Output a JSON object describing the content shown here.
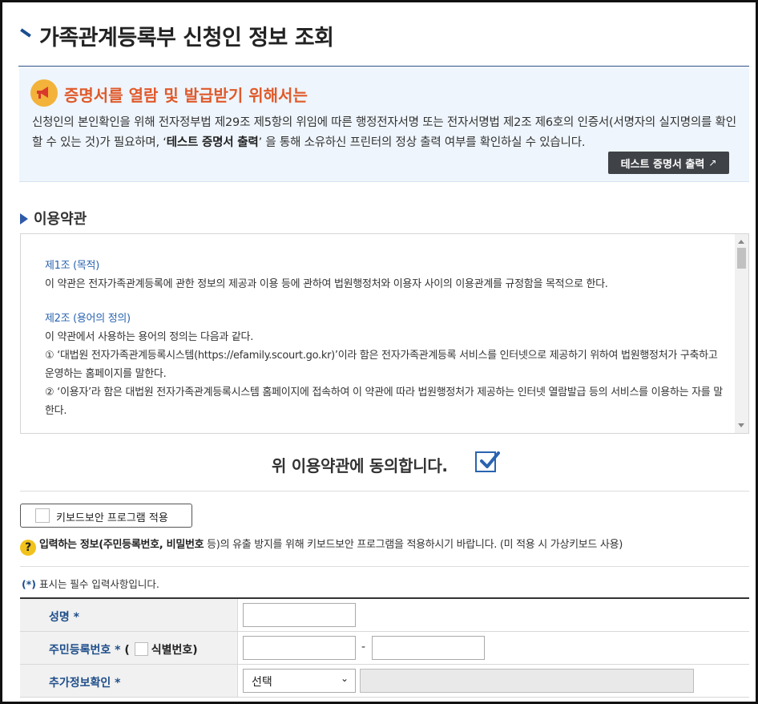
{
  "page": {
    "title": "가족관계등록부 신청인 정보 조회"
  },
  "notice": {
    "icon": "megaphone-icon",
    "heading": "증명서를 열람 및 발급받기 위해서는",
    "body_part1": "신청인의 본인확인을 위해 전자정부법 제29조 제5항의 위임에 따른 행정전자서명 또는 전자서명법 제2조 제6호의 인증서(서명자의 실지명의를 확인할 수 있는 것)가 필요하며, ‘",
    "body_bold": "테스트 증명서 출력",
    "body_part2": "’ 을 통해 소유하신 프린터의 정상 출력 여부를 확인하실 수 있습니다.",
    "test_print_label": "테스트 증명서 출력",
    "external_icon": "↗"
  },
  "terms": {
    "section_title": "이용약관",
    "article1_title": "제1조 (목적)",
    "article1_text": "이 약관은 전자가족관계등록에 관한 정보의 제공과 이용 등에 관하여 법원행정처와 이용자 사이의 이용관계를 규정함을 목적으로 한다.",
    "article2_title": "제2조 (용어의 정의)",
    "article2_intro": "이 약관에서 사용하는 용어의 정의는 다음과 같다.",
    "article2_item1": "① ‘대법원 전자가족관계등록시스템(https://efamily.scourt.go.kr)’이라 함은 전자가족관계등록 서비스를 인터넷으로 제공하기 위하여 법원행정처가 구축하고 운영하는 홈페이지를 말한다.",
    "article2_item2": "② ‘이용자’라 함은 대법원 전자가족관계등록시스템 홈페이지에 접속하여 이 약관에 따라 법원행정처가 제공하는 인터넷 열람발급 등의 서비스를 이용하는 자를 말한다.",
    "agree_label": "위 이용약관에 동의합니다.",
    "agree_checked": true
  },
  "security": {
    "keyboard_button_label": "키보드보안 프로그램 적용",
    "keyboard_checked": false,
    "help_prefix": "입력하는 정보(",
    "help_bold": "주민등록번호, 비밀번호",
    "help_suffix": " 등)의 유출 방지를 위해 키보드보안 프로그램을 적용하시기 바랍니다. (미 적용 시 가상키보드 사용)",
    "help_bold_lead": "입력하는 정보",
    "help_icon": "?"
  },
  "form": {
    "required_note_star": "(*)",
    "required_note": " 표시는 필수 입력사항입니다.",
    "star": "*",
    "name_label": "성명",
    "name_value": "",
    "rrn_label": "주민등록번호",
    "rrn_open_paren": "(",
    "rrn_id_label": "식별번호",
    "rrn_close_paren": ")",
    "rrn_front": "",
    "rrn_dash": "-",
    "rrn_back": "",
    "extra_label": "추가정보확인",
    "extra_select_value": "선택",
    "extra_value": ""
  },
  "colors": {
    "accent_blue": "#1f4e8a",
    "notice_orange": "#e05a2b",
    "notice_bg": "#eef5fc",
    "dark_button": "#3f4247"
  }
}
